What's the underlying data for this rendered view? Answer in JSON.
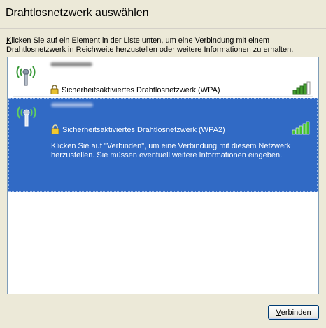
{
  "title": "Drahtlosnetzwerk auswählen",
  "intro": {
    "accel": "K",
    "rest": "licken Sie auf ein Element in der Liste unten, um eine Verbindung mit einem Drahtlosnetzwerk in Reichweite herzustellen oder weitere Informationen zu erhalten."
  },
  "networks": [
    {
      "security": "Sicherheitsaktiviertes Drahtlosnetzwerk (WPA)",
      "signal_bars": 4,
      "selected": false,
      "icon": "wireless-antenna-icon"
    },
    {
      "security": "Sicherheitsaktiviertes Drahtlosnetzwerk (WPA2)",
      "signal_bars": 5,
      "selected": true,
      "icon": "wireless-antenna-icon",
      "description": "Klicken Sie auf \"Verbinden\", um eine Verbindung mit diesem Netzwerk herzustellen. Sie müssen eventuell weitere Informationen eingeben."
    }
  ],
  "connect_button": {
    "accel": "V",
    "rest": "erbinden"
  },
  "colors": {
    "selection": "#316ac5",
    "signal_on": "#44a030",
    "background": "#ece9d8"
  }
}
